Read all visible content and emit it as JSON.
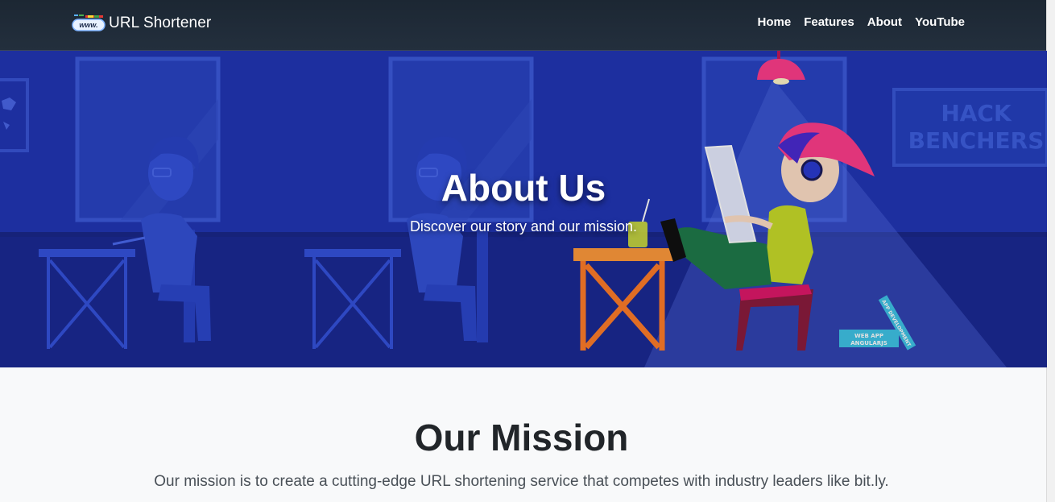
{
  "navbar": {
    "brand_icon": "url-chain-logo-icon",
    "brand_icon_text": "www.",
    "brand_title": "URL Shortener",
    "links": [
      "Home",
      "Features",
      "About",
      "YouTube"
    ]
  },
  "hero": {
    "title": "About Us",
    "subtitle": "Discover our story and our mission.",
    "sign_text": [
      "HACK",
      "BENCHERS"
    ],
    "book_labels": [
      "WEB APP",
      "ANGULARJS",
      "APP DEVELOPMENT"
    ]
  },
  "mission": {
    "title": "Our Mission",
    "text": "Our mission is to create a cutting-edge URL shortening service that competes with industry leaders like bit.ly."
  },
  "colors": {
    "navbar_bg": "#1f2a37",
    "hero_bg": "#1d2fa3",
    "page_bg": "#f8f9fa",
    "accent_pink": "#ff3d8b",
    "accent_yellow": "#d6e63a"
  }
}
